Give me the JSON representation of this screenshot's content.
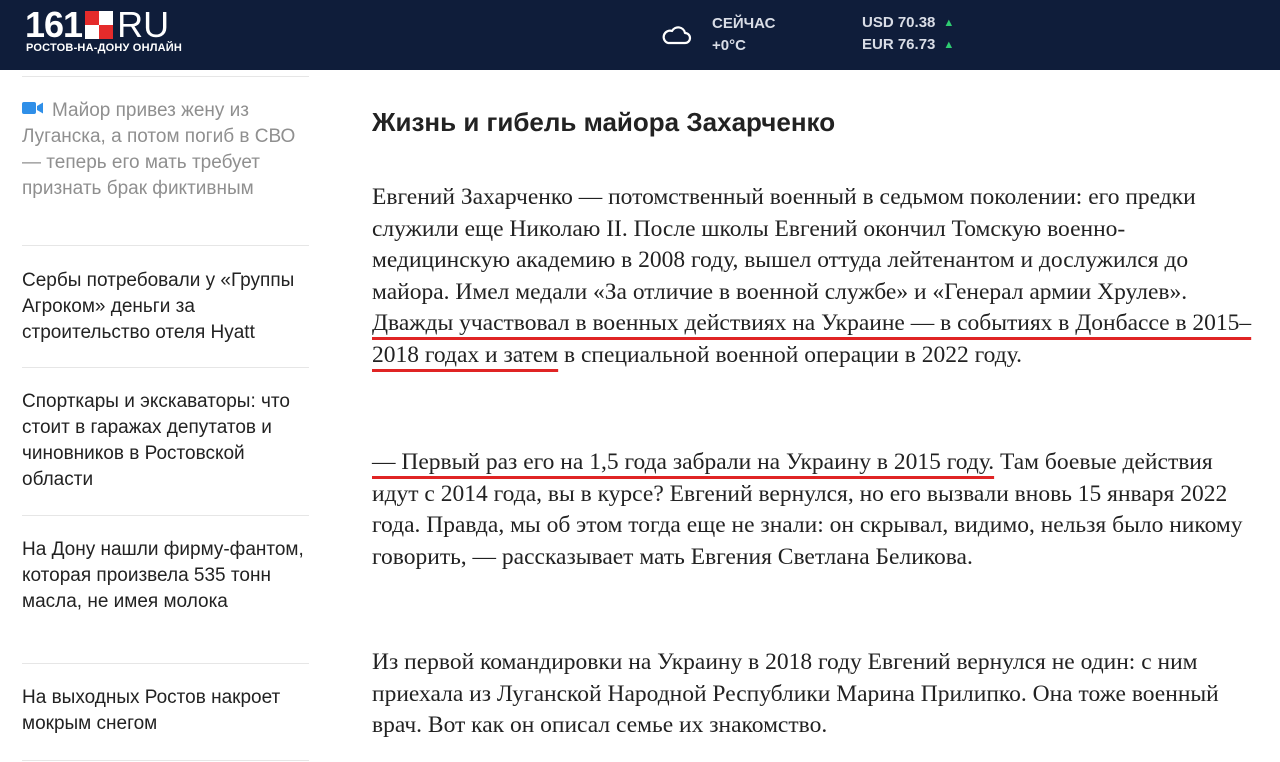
{
  "header": {
    "logo_number": "161",
    "logo_domain": "RU",
    "logo_subtitle": "РОСТОВ-НА-ДОНУ ОНЛАЙН",
    "weather_label": "СЕЙЧАС",
    "weather_temp": "+0°C",
    "currency": [
      {
        "label": "USD 70.38",
        "trend": "▲"
      },
      {
        "label": "EUR 76.73",
        "trend": "▲"
      }
    ]
  },
  "sidebar": {
    "items": [
      {
        "title": "Майор привез жену из Луганска, а потом погиб в СВО — теперь его мать требует признать брак фиктивным",
        "icon": "video-camera-icon"
      },
      {
        "title": "Сербы потребовали у «Группы Агроком» деньги за строительство отеля Hyatt"
      },
      {
        "title": "Спорткары и экскаваторы: что стоит в гаражах депутатов и чиновников в Ростовской области"
      },
      {
        "title": "На Дону нашли фирму-фантом, которая произвела 535 тонн масла, не имея молока"
      },
      {
        "title": "На выходных Ростов накроет мокрым снегом"
      }
    ]
  },
  "article": {
    "heading": "Жизнь и гибель майора Захарченко",
    "p1_a": "Евгений Захарченко — потомственный военный в седьмом поколении: его предки служили еще Николаю II. После школы Евгений окончил Томскую военно-медицинскую академию в 2008 году, вышел оттуда лейтенантом и дослужился до майора. Имел медали «За отличие в военной службе» и «Генерал армии Хрулев». ",
    "p1_u": "Дважды участвовал в военных действиях на Украине — в событиях в Донбассе в 2015–2018 годах и затем",
    "p1_b": " в специальной военной операции в 2022 году.",
    "p2_u": "— Первый раз его на 1,5 года забрали на Украину в 2015 году.",
    "p2_b": " Там боевые действия идут с 2014 года, вы в курсе? Евгений вернулся, но его вызвали вновь 15 января 2022 года. Правда, мы об этом тогда еще не знали: он скрывал, видимо, нельзя было никому говорить, — рассказывает мать Евгения Светлана Беликова.",
    "p3": "Из первой командировки на Украину в 2018 году Евгений вернулся не один: с ним приехала из Луганской Народной Республики Марина Прилипко. Она тоже военный врач. Вот как он описал семье их знакомство."
  },
  "colors": {
    "header_bg": "#0f1d3a",
    "logo_accent": "#e52b2b",
    "underline": "#e02424",
    "trend_up": "#2ecc71",
    "video_icon": "#2f8fe8"
  }
}
